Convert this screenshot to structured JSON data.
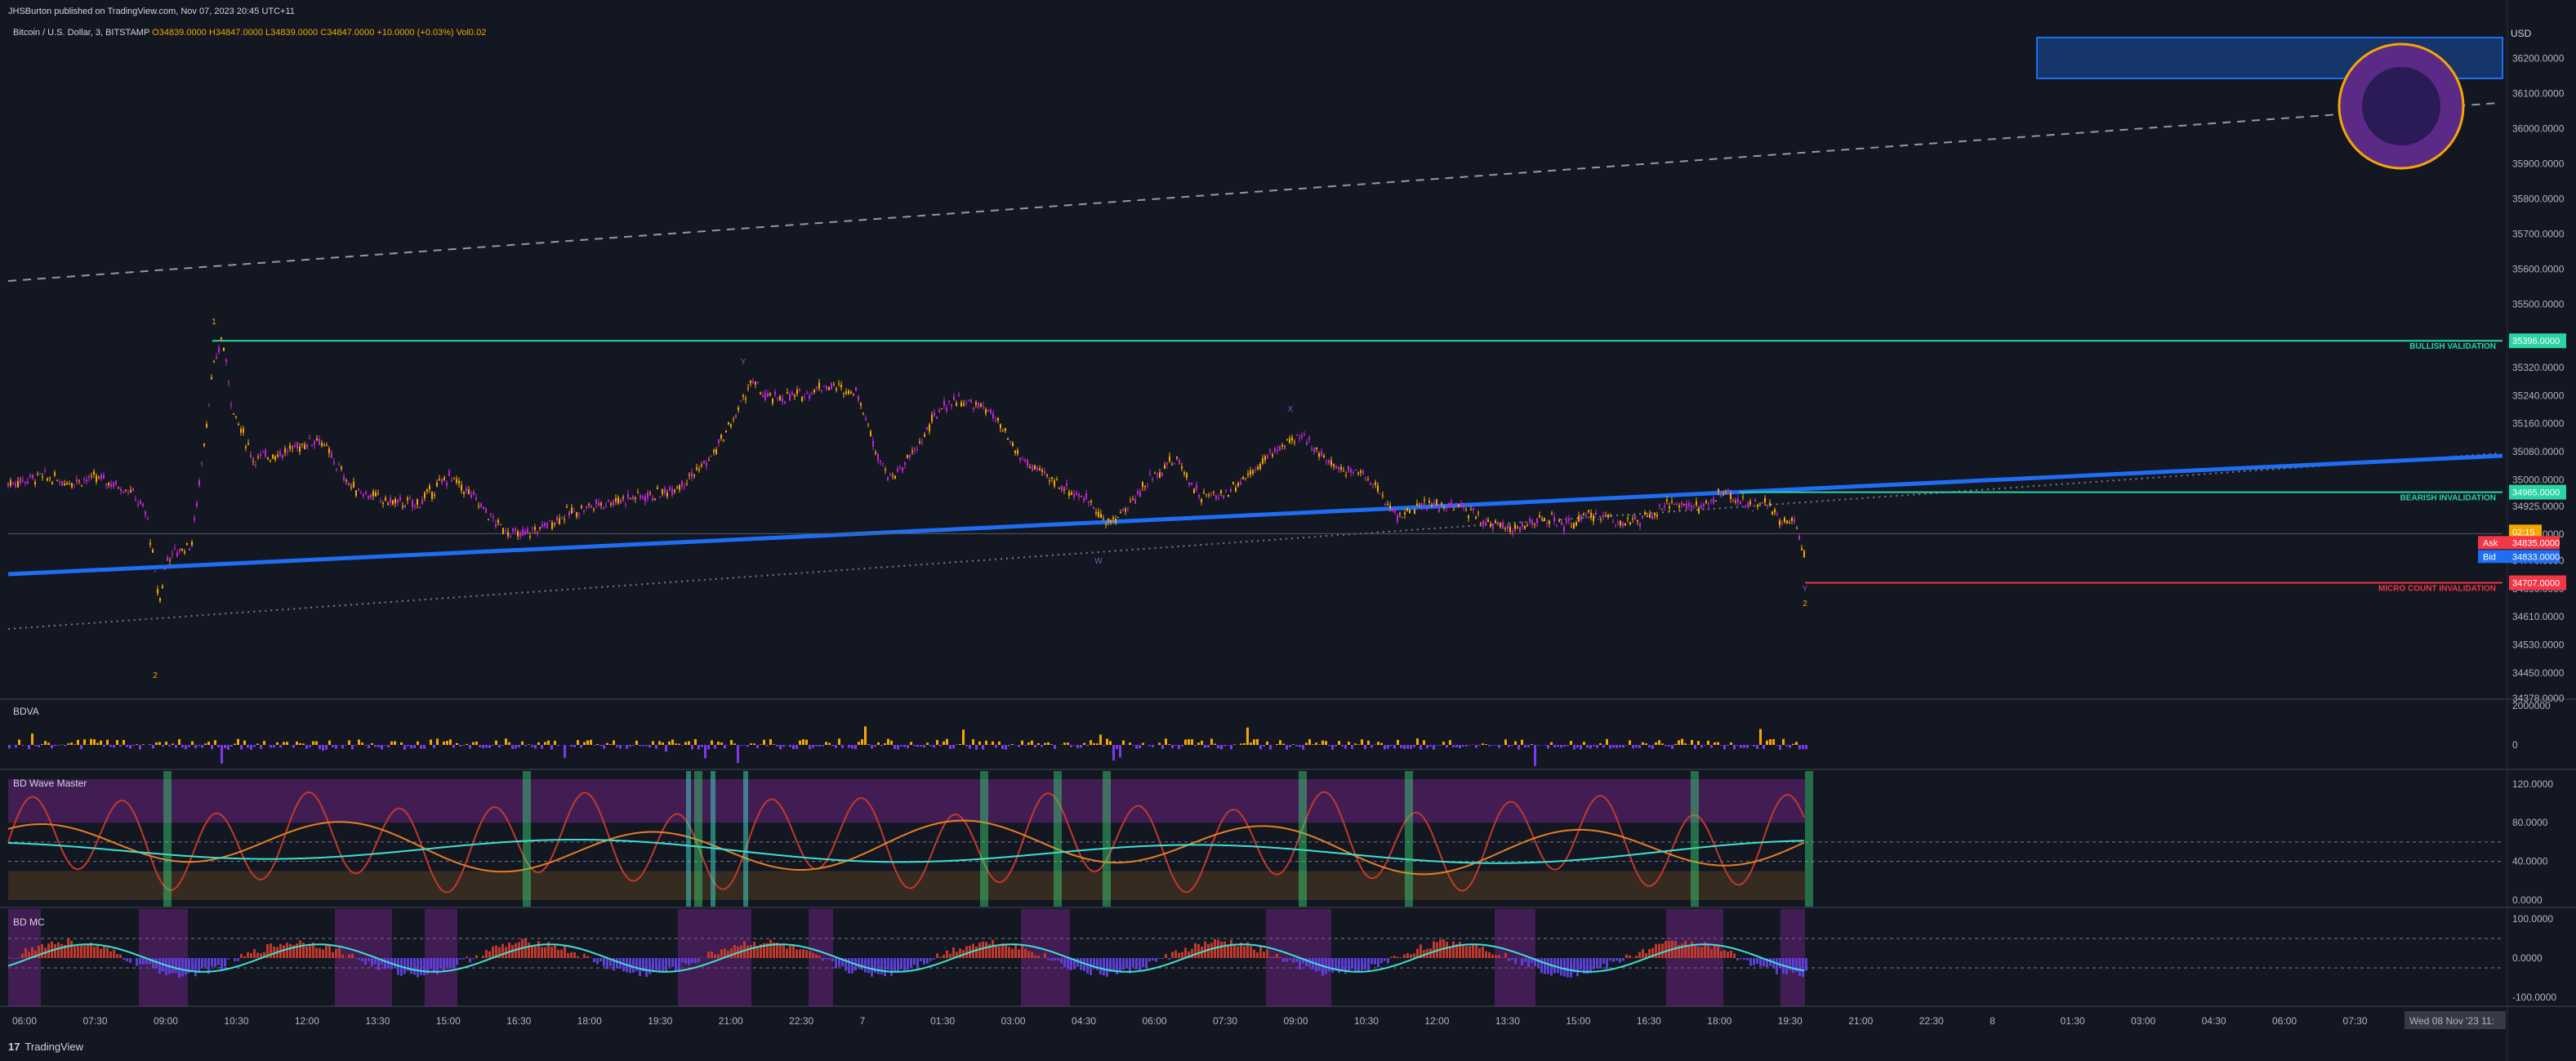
{
  "header": {
    "published": "JHSBurton published on TradingView.com, Nov 07, 2023 20:45 UTC+11",
    "symbol": "Bitcoin / U.S. Dollar, 3, BITSTAMP",
    "ohlc": "O34839.0000  H34847.0000  L34839.0000  C34847.0000  +10.0000 (+0.03%)  Vol0.02"
  },
  "currency": "USD",
  "footer": {
    "brand": "TradingView"
  },
  "colors": {
    "bg": "#131722",
    "bull": "#f7a600",
    "bear": "#c026d3",
    "trend": "#1e6ef4",
    "bullish_validation": "#2bd4a5",
    "micro_invalidation": "#f23645",
    "cyan": "#3fe0d0"
  },
  "panels": {
    "bdva": "BDVA",
    "wave": "BD Wave Master",
    "mc": "BD MC"
  },
  "levels": {
    "bullish_validation": {
      "label": "BULLISH VALIDATION",
      "price": "35396.0000"
    },
    "bearish_validation": {
      "label": "BEARISH INVALIDATION",
      "price": "34965.0000"
    },
    "micro_invalidation": {
      "label": "MICRO COUNT INVALIDATION",
      "price": "34707.0000"
    }
  },
  "price_tags": {
    "countdown": "02:15",
    "ask_label": "Ask",
    "ask": "34835.0000",
    "bid_label": "Bid",
    "bid": "34833.0000"
  },
  "wave_labels": [
    "1",
    "2",
    "Y",
    "W",
    "X",
    "Y",
    "2",
    "C",
    "2"
  ],
  "chart_data": {
    "type": "candlestick",
    "y_axis": {
      "ticks": [
        "36200.0000",
        "36100.0000",
        "36000.0000",
        "35900.0000",
        "35800.0000",
        "35700.0000",
        "35600.0000",
        "35500.0000",
        "35320.0000",
        "35240.0000",
        "35160.0000",
        "35080.0000",
        "35000.0000",
        "34925.0000",
        "34845.0000",
        "34770.0000",
        "34690.0000",
        "34610.0000",
        "34530.0000",
        "34450.0000",
        "34378.0000"
      ]
    },
    "x_axis": {
      "ticks": [
        "06:00",
        "07:30",
        "09:00",
        "10:30",
        "12:00",
        "13:30",
        "15:00",
        "16:30",
        "18:00",
        "19:30",
        "21:00",
        "22:30",
        "7",
        "01:30",
        "03:00",
        "04:30",
        "06:00",
        "07:30",
        "09:00",
        "10:30",
        "12:00",
        "13:30",
        "15:00",
        "16:30",
        "18:00",
        "19:30",
        "21:00",
        "22:30",
        "8",
        "01:30",
        "03:00",
        "04:30",
        "06:00",
        "07:30",
        "09:00"
      ],
      "cursor_label": "Wed 08 Nov '23   11:"
    },
    "price_path": [
      [
        0,
        34990
      ],
      [
        40,
        35010
      ],
      [
        70,
        34995
      ],
      [
        110,
        35005
      ],
      [
        150,
        34970
      ],
      [
        170,
        34900
      ],
      [
        185,
        34650
      ],
      [
        195,
        34780
      ],
      [
        225,
        34820
      ],
      [
        250,
        35300
      ],
      [
        262,
        35410
      ],
      [
        275,
        35200
      ],
      [
        300,
        35060
      ],
      [
        340,
        35080
      ],
      [
        380,
        35120
      ],
      [
        420,
        34980
      ],
      [
        460,
        34940
      ],
      [
        500,
        34930
      ],
      [
        540,
        35010
      ],
      [
        570,
        34950
      ],
      [
        600,
        34870
      ],
      [
        625,
        34840
      ],
      [
        650,
        34860
      ],
      [
        680,
        34900
      ],
      [
        720,
        34930
      ],
      [
        760,
        34950
      ],
      [
        800,
        34960
      ],
      [
        830,
        35000
      ],
      [
        860,
        35060
      ],
      [
        890,
        35180
      ],
      [
        910,
        35280
      ],
      [
        930,
        35230
      ],
      [
        970,
        35240
      ],
      [
        1000,
        35270
      ],
      [
        1040,
        35250
      ],
      [
        1060,
        35100
      ],
      [
        1080,
        35000
      ],
      [
        1110,
        35080
      ],
      [
        1140,
        35200
      ],
      [
        1160,
        35230
      ],
      [
        1200,
        35200
      ],
      [
        1240,
        35060
      ],
      [
        1270,
        35010
      ],
      [
        1300,
        34970
      ],
      [
        1330,
        34930
      ],
      [
        1345,
        34870
      ],
      [
        1370,
        34920
      ],
      [
        1400,
        35010
      ],
      [
        1430,
        35060
      ],
      [
        1460,
        34950
      ],
      [
        1490,
        34960
      ],
      [
        1520,
        35020
      ],
      [
        1560,
        35100
      ],
      [
        1590,
        35120
      ],
      [
        1620,
        35040
      ],
      [
        1660,
        35020
      ],
      [
        1700,
        34900
      ],
      [
        1740,
        34930
      ],
      [
        1780,
        34920
      ],
      [
        1810,
        34880
      ],
      [
        1850,
        34860
      ],
      [
        1880,
        34890
      ],
      [
        1910,
        34870
      ],
      [
        1940,
        34900
      ],
      [
        1980,
        34880
      ],
      [
        2010,
        34890
      ],
      [
        2040,
        34940
      ],
      [
        2070,
        34920
      ],
      [
        2100,
        34960
      ],
      [
        2130,
        34930
      ],
      [
        2150,
        34930
      ],
      [
        2170,
        34890
      ],
      [
        2190,
        34870
      ],
      [
        2200,
        34785
      ],
      [
        2210,
        34847
      ]
    ],
    "price_range": [
      34378,
      36250
    ],
    "bdva_range": [
      -800000,
      2000000
    ],
    "bdva_ticks": [
      "2000000",
      "0"
    ],
    "wave_ticks": [
      "120.0000",
      "80.0000",
      "40.0000",
      "0.0000"
    ],
    "mc_ticks": [
      "100.0000",
      "0.0000",
      "-100.0000"
    ]
  }
}
